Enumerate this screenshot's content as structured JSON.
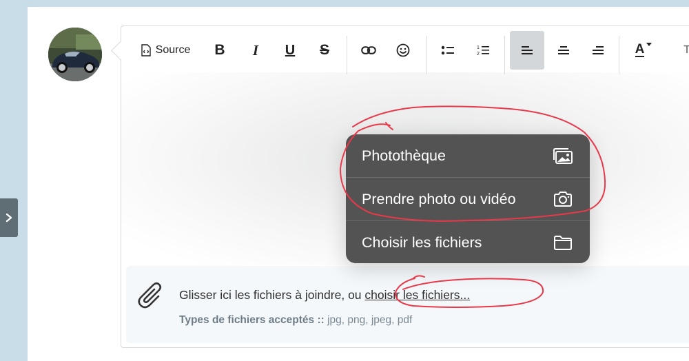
{
  "sidebar": {
    "toggle_icon": "chevron-right-icon"
  },
  "editor": {
    "toolbar": {
      "source_label": "Source",
      "bold_label": "B",
      "italic_label": "I",
      "underline_label": "U",
      "strike_label": "S",
      "text_color_label": "A",
      "more_label": "T",
      "active_align": "left"
    }
  },
  "context_menu": {
    "items": [
      {
        "label": "Photothèque",
        "icon": "photo-library-icon"
      },
      {
        "label": "Prendre photo ou vidéo",
        "icon": "camera-icon"
      },
      {
        "label": "Choisir les fichiers",
        "icon": "folder-icon"
      }
    ]
  },
  "attachments": {
    "prompt_text": "Glisser ici les fichiers à joindre, ou ",
    "link_text": "choisir les fichiers...",
    "types_label": "Types de fichiers acceptés ::",
    "types_value": " jpg, png, jpeg, pdf"
  },
  "colors": {
    "page_background": "#c9dde9",
    "menu_background": "#535353",
    "annotation_red": "#e8394a",
    "active_button": "#d4d7da"
  }
}
